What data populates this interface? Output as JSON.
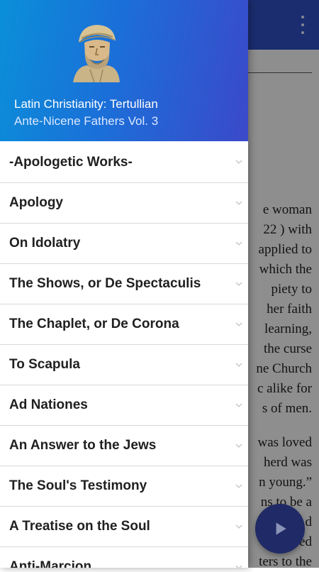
{
  "drawer": {
    "header": {
      "title": "Latin Christianity: Tertullian",
      "subtitle": "Ante-Nicene Fathers Vol. 3",
      "portrait_icon": "tertullian-portrait"
    },
    "items": [
      {
        "label": "-Apologetic Works-"
      },
      {
        "label": "Apology"
      },
      {
        "label": "On Idolatry"
      },
      {
        "label": "The Shows, or De Spectaculis"
      },
      {
        "label": "The Chaplet, or De Corona"
      },
      {
        "label": "To Scapula"
      },
      {
        "label": "Ad Nationes"
      },
      {
        "label": "An Answer to the Jews"
      },
      {
        "label": "The Soul's Testimony"
      },
      {
        "label": "A Treatise on the Soul"
      },
      {
        "label": "Anti-Marcion"
      }
    ]
  },
  "background": {
    "lines_a": [
      "e woman",
      "22 ) with",
      "applied to",
      "which the",
      "piety to",
      "her faith",
      "learning,",
      "the curse",
      "ne Church",
      "c alike for",
      "s of men."
    ],
    "lines_b": [
      "was loved",
      "herd was",
      "n young.”",
      "ns to be a",
      "n d",
      "le ed",
      "ters to the"
    ]
  },
  "colors": {
    "toolbar": "#2f4ec0",
    "fab": "#1f2a66",
    "header_gradient_start": "#0a8fd9",
    "header_gradient_end": "#3b49c9"
  }
}
